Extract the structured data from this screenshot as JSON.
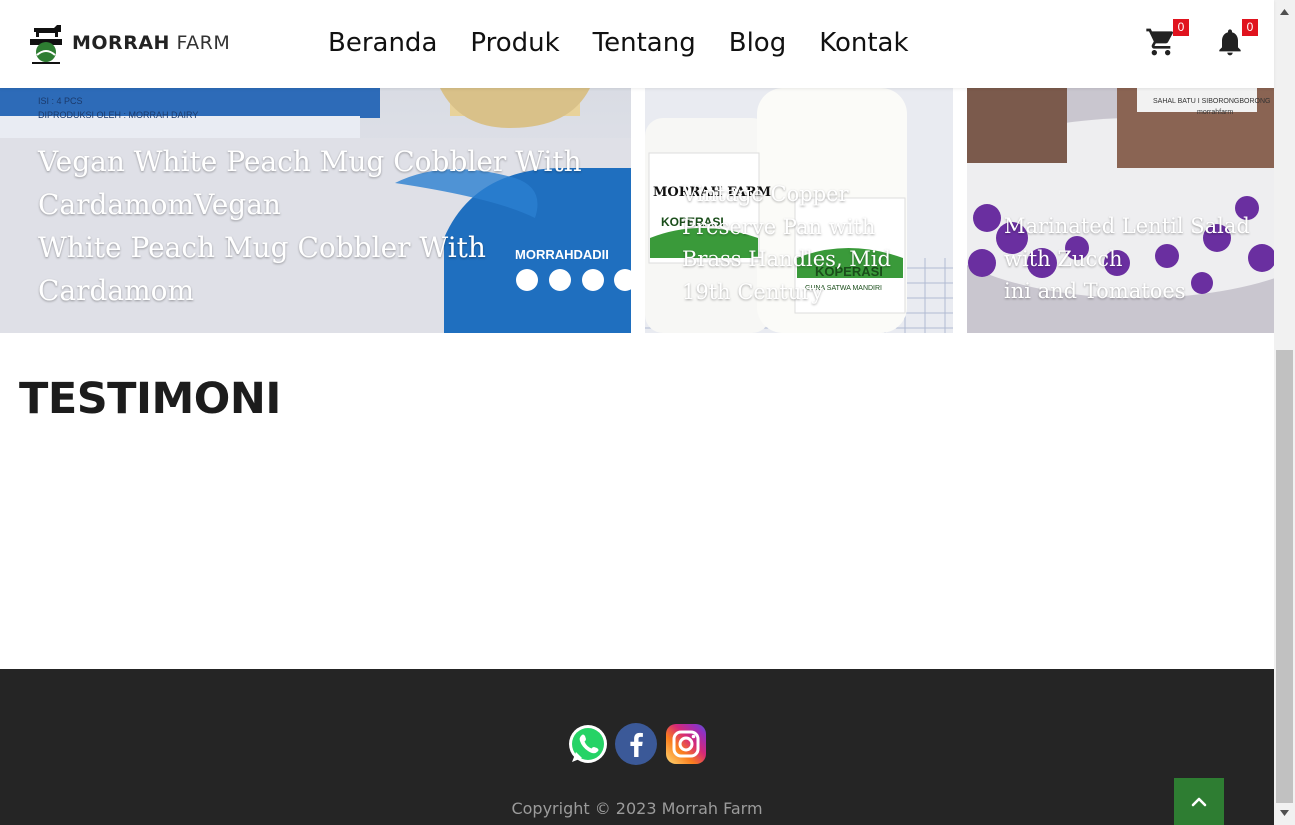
{
  "brand": {
    "name_bold": "MORRAH",
    "name_light": "FARM"
  },
  "nav": {
    "items": [
      "Beranda",
      "Produk",
      "Tentang",
      "Blog",
      "Kontak"
    ]
  },
  "header_icons": {
    "cart_icon": "shopping-cart-icon",
    "cart_count": "0",
    "bell_icon": "bell-icon",
    "notification_count": "0"
  },
  "cards": [
    {
      "title_lines": [
        "Vegan White Peach Mug Cobbler With",
        "CardamomVegan",
        "White Peach Mug Cobbler With",
        "Cardamom"
      ],
      "image_text": {
        "pack_info_1": "ISI : 4 PCS",
        "pack_info_2": "DIPRODUKSI OLEH : MORRAH DAIRY",
        "handle": "MORRAHDADII"
      }
    },
    {
      "title_lines": [
        "Vintage Copper",
        "Preserve Pan with",
        "Brass Handles, Mid",
        "19th Century"
      ],
      "image_text": {
        "label_brand": "MORRAH FARM",
        "label_koperasi": "KOPERASI",
        "label_sub": "GUNA SATWA MANDIRI"
      }
    },
    {
      "title_lines": [
        "Marinated Lentil Salad",
        "with Zucch",
        "ini and Tomatoes"
      ],
      "image_text": {
        "label": "SAHAL BATU I SIBORONGBORONG",
        "handle": "morrahfarm"
      }
    }
  ],
  "testimoni": {
    "title": "TESTIMONI"
  },
  "footer": {
    "social_icons": [
      "whatsapp-icon",
      "facebook-icon",
      "instagram-icon"
    ],
    "copyright": "Copyright © 2023 Morrah Farm",
    "back_to_top_icon": "chevron-up-icon"
  },
  "colors": {
    "badge": "#e0131e",
    "footer_bg": "#252525",
    "back_to_top": "#2e7d32",
    "facebook": "#3b5998",
    "whatsapp": "#25d366"
  }
}
